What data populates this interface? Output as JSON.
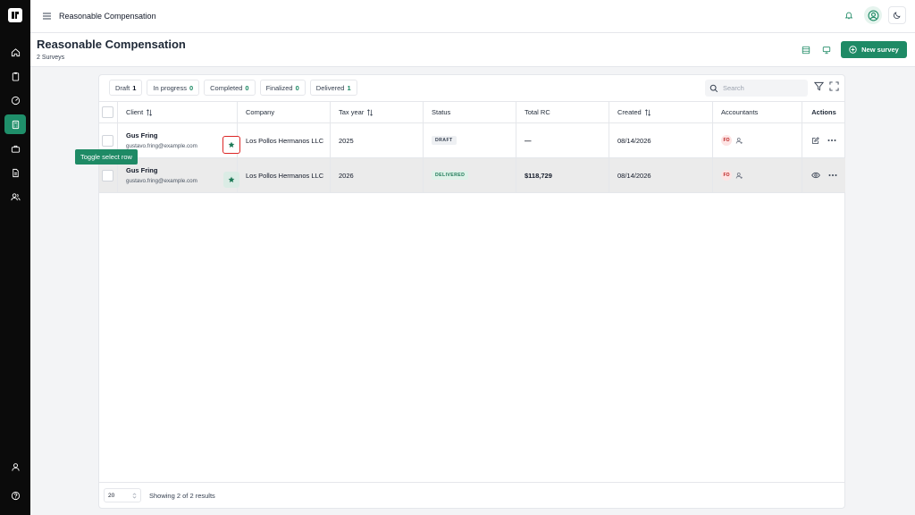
{
  "app": {
    "topbar_title": "Reasonable Compensation"
  },
  "header": {
    "title": "Reasonable Compensation",
    "subtitle": "2 Surveys",
    "new_survey_label": "New survey"
  },
  "filters": [
    {
      "label": "Draft",
      "count": "1"
    },
    {
      "label": "In progress",
      "count": "0"
    },
    {
      "label": "Completed",
      "count": "0"
    },
    {
      "label": "Finalized",
      "count": "0"
    },
    {
      "label": "Delivered",
      "count": "1"
    }
  ],
  "search": {
    "placeholder": "Search"
  },
  "columns": {
    "client": "Client",
    "company": "Company",
    "tax_year": "Tax year",
    "status": "Status",
    "total_rc": "Total RC",
    "created": "Created",
    "accountants": "Accountants",
    "actions": "Actions"
  },
  "rows": [
    {
      "client_name": "Gus Fring",
      "client_email": "gustavo.fring@example.com",
      "company": "Los Pollos Hermanos LLC",
      "tax_year": "2025",
      "status": "DRAFT",
      "total_rc": "—",
      "created": "08/14/2026",
      "accountant_initials": "FO"
    },
    {
      "client_name": "Gus Fring",
      "client_email": "gustavo.fring@example.com",
      "company": "Los Pollos Hermanos LLC",
      "tax_year": "2026",
      "status": "DELIVERED",
      "total_rc": "$118,729",
      "created": "08/14/2026",
      "accountant_initials": "FO"
    }
  ],
  "tooltip": "Toggle select row",
  "footer": {
    "page_size": "20",
    "results_text": "Showing 2 of 2 results"
  },
  "colors": {
    "accent": "#1e8a65",
    "sidebar": "#0b0b0b",
    "focus_ring": "#dc2626"
  }
}
